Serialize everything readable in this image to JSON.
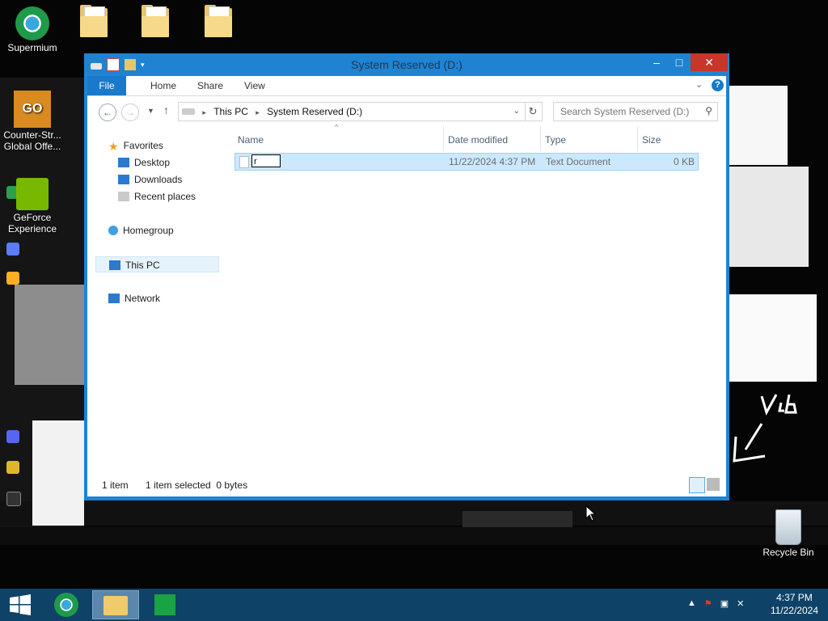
{
  "desktop": {
    "icons": [
      {
        "label": "Supermium"
      },
      {
        "label": "Counter-Str... Global Offe..."
      },
      {
        "label": "GeForce Experience"
      },
      {
        "label": "Recycle Bin"
      }
    ]
  },
  "window": {
    "title": "System Reserved (D:)",
    "ribbon_tabs": [
      "File",
      "Home",
      "Share",
      "View"
    ],
    "address": {
      "crumbs": [
        "This PC",
        "System Reserved (D:)"
      ]
    },
    "search_placeholder": "Search System Reserved (D:)",
    "nav": {
      "favorites": "Favorites",
      "favorites_items": [
        "Desktop",
        "Downloads",
        "Recent places"
      ],
      "homegroup": "Homegroup",
      "this_pc": "This PC",
      "network": "Network"
    },
    "columns": [
      "Name",
      "Date modified",
      "Type",
      "Size"
    ],
    "files": [
      {
        "name": "r",
        "date": "11/22/2024 4:37 PM",
        "type": "Text Document",
        "size": "0 KB"
      }
    ],
    "status": {
      "count": "1 item",
      "selected": "1 item selected  0 bytes"
    }
  },
  "taskbar": {
    "time": "4:37 PM",
    "date": "11/22/2024"
  },
  "colors": {
    "accent": "#1f83d2",
    "taskbar": "#0f4267",
    "selection": "#cce8ff"
  }
}
